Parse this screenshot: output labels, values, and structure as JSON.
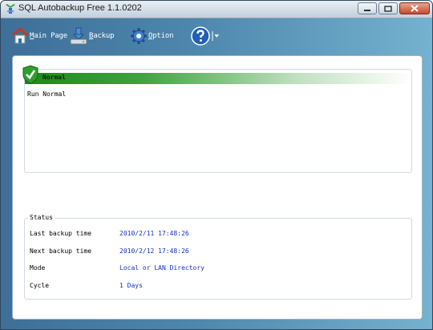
{
  "window": {
    "title": "SQL Autobackup Free 1.1.0202"
  },
  "toolbar": {
    "main_page": {
      "hotkey": "M",
      "rest": "ain Page"
    },
    "backup": {
      "hotkey": "B",
      "rest": "ackup"
    },
    "option": {
      "hotkey": "O",
      "rest": "ption"
    }
  },
  "message": {
    "header": "Normal",
    "body": "Run Normal"
  },
  "status": {
    "legend": "Status",
    "rows": [
      {
        "label": "Last backup time",
        "value": "2010/2/11 17:48:26"
      },
      {
        "label": "Next backup time",
        "value": "2010/2/12 17:48:26"
      },
      {
        "label": "Mode",
        "value": "Local or LAN Directory"
      },
      {
        "label": "Cycle",
        "value": "1 Days"
      }
    ]
  },
  "colors": {
    "accent_blue": "#1431c8",
    "normal_green": "#1b8a1b"
  }
}
